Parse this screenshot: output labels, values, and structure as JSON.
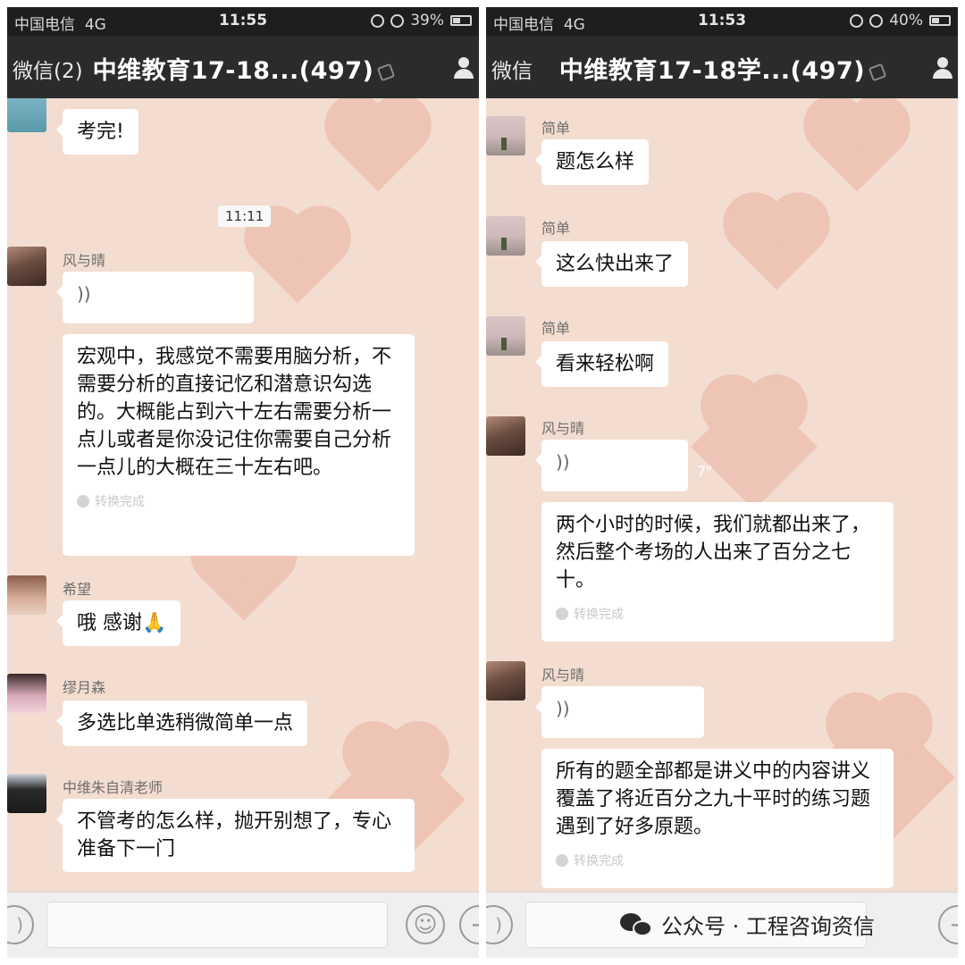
{
  "status_left": {
    "carrier": "中国电信",
    "network": "4G",
    "time": "11:55",
    "battery": "39%",
    "battery_level": 0.39
  },
  "status_right": {
    "carrier": "中国电信",
    "network": "4G",
    "time": "11:53",
    "battery": "40%",
    "battery_level": 0.4
  },
  "left_nav": {
    "back": "微信(2)",
    "title": "中维教育17-18...(497)"
  },
  "right_nav": {
    "back": "微信",
    "title": "中维教育17-18学...(497)"
  },
  "left_chat": {
    "top_message": "考完!",
    "timestamp": "11:11",
    "m1": {
      "sender": "风与晴",
      "voice": "))",
      "text": "宏观中，我感觉不需要用脑分析，不需要分析的直接记忆和潜意识勾选的。大概能占到六十左右需要分析一点儿或者是你没记住你需要自己分析一点儿的大概在三十左右吧。",
      "status": "转换完成"
    },
    "m2": {
      "sender": "希望",
      "text": "哦 感谢🙏"
    },
    "m3": {
      "sender": "缪月森",
      "text": "多选比单选稍微简单一点"
    },
    "m4": {
      "sender": "中维朱自清老师",
      "text": "不管考的怎么样，抛开别想了，专心准备下一门"
    }
  },
  "right_chat": {
    "m1": {
      "sender": "简单",
      "text": "题怎么样"
    },
    "m2": {
      "sender": "简单",
      "text": "这么快出来了"
    },
    "m3": {
      "sender": "简单",
      "text": "看来轻松啊"
    },
    "m4": {
      "sender": "风与晴",
      "voice": "))",
      "voice_duration": "7\"",
      "text": "两个小时的时候，我们就都出来了，然后整个考场的人出来了百分之七十。",
      "status": "转换完成"
    },
    "m5": {
      "sender": "风与晴",
      "voice": "))",
      "text": "所有的题全部都是讲义中的内容讲义覆盖了将近百分之九十平时的练习题遇到了好多原题。",
      "status": "转换完成"
    }
  },
  "input_bar": {
    "emoji_icon": "☺",
    "plus_icon": "+",
    "voice_icon": ")"
  },
  "watermark": "公众号 · 工程咨询资信"
}
